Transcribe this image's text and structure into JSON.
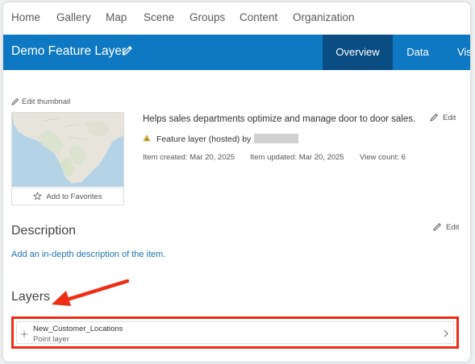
{
  "nav": {
    "items": [
      "Home",
      "Gallery",
      "Map",
      "Scene",
      "Groups",
      "Content",
      "Organization"
    ]
  },
  "header": {
    "title": "Demo Feature Layer",
    "tabs": [
      "Overview",
      "Data",
      "Vis"
    ],
    "active_tab": "Overview"
  },
  "details": {
    "edit_thumbnail_label": "Edit thumbnail",
    "add_favorites_label": "Add to Favorites",
    "summary": "Helps sales departments optimize and manage door to door sales.",
    "edit_label": "Edit",
    "type_label": "Feature layer (hosted) by",
    "created": "Item created: Mar 20, 2025",
    "updated": "Item updated: Mar 20, 2025",
    "views": "View count: 6"
  },
  "description": {
    "heading": "Description",
    "edit_label": "Edit",
    "link": "Add an in-depth description of the item."
  },
  "layers": {
    "heading": "Layers",
    "items": [
      {
        "name": "New_Customer_Locations",
        "type": "Point layer"
      }
    ]
  },
  "colors": {
    "header_blue": "#0e79c2",
    "active_tab": "#0a4d82",
    "link_blue": "#1c74b3",
    "highlight_red": "#ee2d15"
  }
}
